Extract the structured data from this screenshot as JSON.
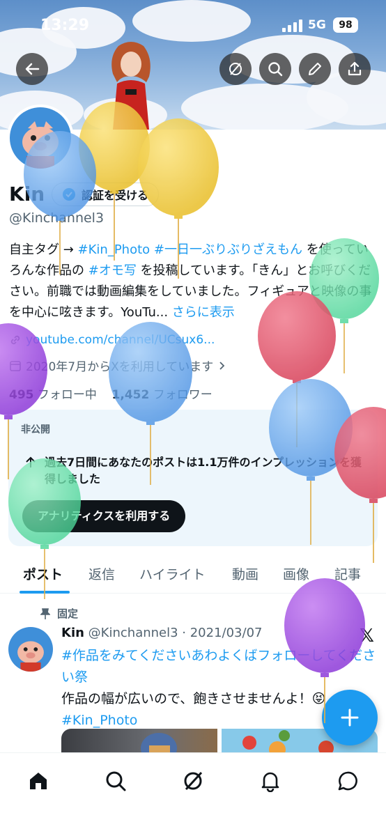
{
  "status": {
    "time": "13:29",
    "network": "5G",
    "battery": "98"
  },
  "header": {
    "back_icon": "back-arrow-icon",
    "actions": [
      "grok-icon",
      "search-icon",
      "edit-icon",
      "share-icon"
    ]
  },
  "profile": {
    "name": "Kin",
    "verify_label": "認証を受ける",
    "handle": "@Kinchannel3",
    "bio_parts": [
      "自主タグ → ",
      "#Kin_Photo",
      " ",
      "#一日一ぶりぶりざえもん",
      " を使っていろんな作品の ",
      "#オモ写",
      " を投稿しています。「きん」とお呼びください。前職では動画編集をしていました。フィギュアと映像の事を中心に呟きます。YouTu...",
      " さらに表示"
    ],
    "website": "youtube.com/channel/UCsux6...",
    "joined": "2020年7月からXを利用しています",
    "following_count": "495",
    "following_label": "フォロー中",
    "followers_count": "1,452",
    "followers_label": "フォロワー"
  },
  "analytics": {
    "private_label": "非公開",
    "message": "過去7日間にあなたのポストは1.1万件のインプレッションを獲得しました",
    "button": "アナリティクスを利用する"
  },
  "tabs": [
    "ポスト",
    "返信",
    "ハイライト",
    "動画",
    "画像",
    "記事"
  ],
  "post": {
    "pinned_label": "固定",
    "author": "Kin",
    "handle_date": "@Kinchannel3 · 2021/03/07",
    "hashtag_line": "#作品をみてくださいあわよくばフォローしてください祭",
    "text": "作品の幅が広いので、飽きさせませんよ！😝",
    "tag2": "#Kin_Photo",
    "x_mark": "𝕏"
  },
  "fab_icon": "plus-icon",
  "bottom_nav": [
    "home-icon",
    "search-icon",
    "grok-icon",
    "notifications-icon",
    "messages-icon"
  ],
  "colors": {
    "accent": "#1d9bf0",
    "text": "#0f1419",
    "muted": "#536471"
  }
}
